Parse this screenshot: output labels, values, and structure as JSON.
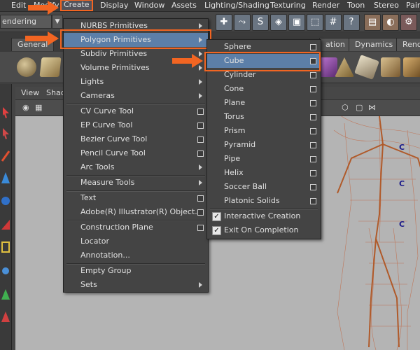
{
  "menubar": {
    "items": [
      "Edit",
      "Modify",
      "Create",
      "Display",
      "Window",
      "Assets",
      "Lighting/Shading",
      "Texturing",
      "Render",
      "Toon",
      "Stereo",
      "Pain"
    ]
  },
  "toolbar": {
    "mode_value": "endering",
    "help_glyph": "?"
  },
  "shelf_tabs": [
    "General",
    "ation",
    "Dynamics",
    "Rend"
  ],
  "panel_menu": [
    "View",
    "Shad"
  ],
  "create_menu": {
    "items": [
      {
        "label": "NURBS Primitives",
        "kind": "sub"
      },
      {
        "label": "Polygon Primitives",
        "kind": "sub",
        "active": true
      },
      {
        "label": "Subdiv Primitives",
        "kind": "sub"
      },
      {
        "label": "Volume Primitives",
        "kind": "sub"
      },
      {
        "label": "Lights",
        "kind": "sub"
      },
      {
        "label": "Cameras",
        "kind": "sub"
      },
      {
        "label": "CV Curve Tool",
        "kind": "opt"
      },
      {
        "label": "EP Curve Tool",
        "kind": "opt"
      },
      {
        "label": "Bezier Curve Tool",
        "kind": "opt"
      },
      {
        "label": "Pencil Curve Tool",
        "kind": "opt"
      },
      {
        "label": "Arc Tools",
        "kind": "sub"
      },
      {
        "label": "Measure Tools",
        "kind": "sub"
      },
      {
        "label": "Text",
        "kind": "opt"
      },
      {
        "label": "Adobe(R) Illustrator(R) Object...",
        "kind": "opt"
      },
      {
        "label": "Construction Plane",
        "kind": "opt"
      },
      {
        "label": "Locator",
        "kind": "none"
      },
      {
        "label": "Annotation...",
        "kind": "none"
      },
      {
        "label": "Empty Group",
        "kind": "none"
      },
      {
        "label": "Sets",
        "kind": "sub"
      }
    ]
  },
  "polygon_menu": {
    "items": [
      {
        "label": "Sphere"
      },
      {
        "label": "Cube",
        "active": true
      },
      {
        "label": "Cylinder"
      },
      {
        "label": "Cone"
      },
      {
        "label": "Plane"
      },
      {
        "label": "Torus"
      },
      {
        "label": "Prism"
      },
      {
        "label": "Pyramid"
      },
      {
        "label": "Pipe"
      },
      {
        "label": "Helix"
      },
      {
        "label": "Soccer Ball"
      },
      {
        "label": "Platonic Solids"
      }
    ],
    "checks": [
      {
        "label": "Interactive Creation",
        "checked": true
      },
      {
        "label": "Exit On Completion",
        "checked": true
      }
    ],
    "check_glyph": "✓"
  },
  "viewport": {
    "joint_marker": "C"
  },
  "colors": {
    "highlight_orange": "#f26522",
    "menu_active": "#5c7fa8",
    "skeleton": "#b05a2a",
    "viewport_bg": "#b4b4b4"
  }
}
